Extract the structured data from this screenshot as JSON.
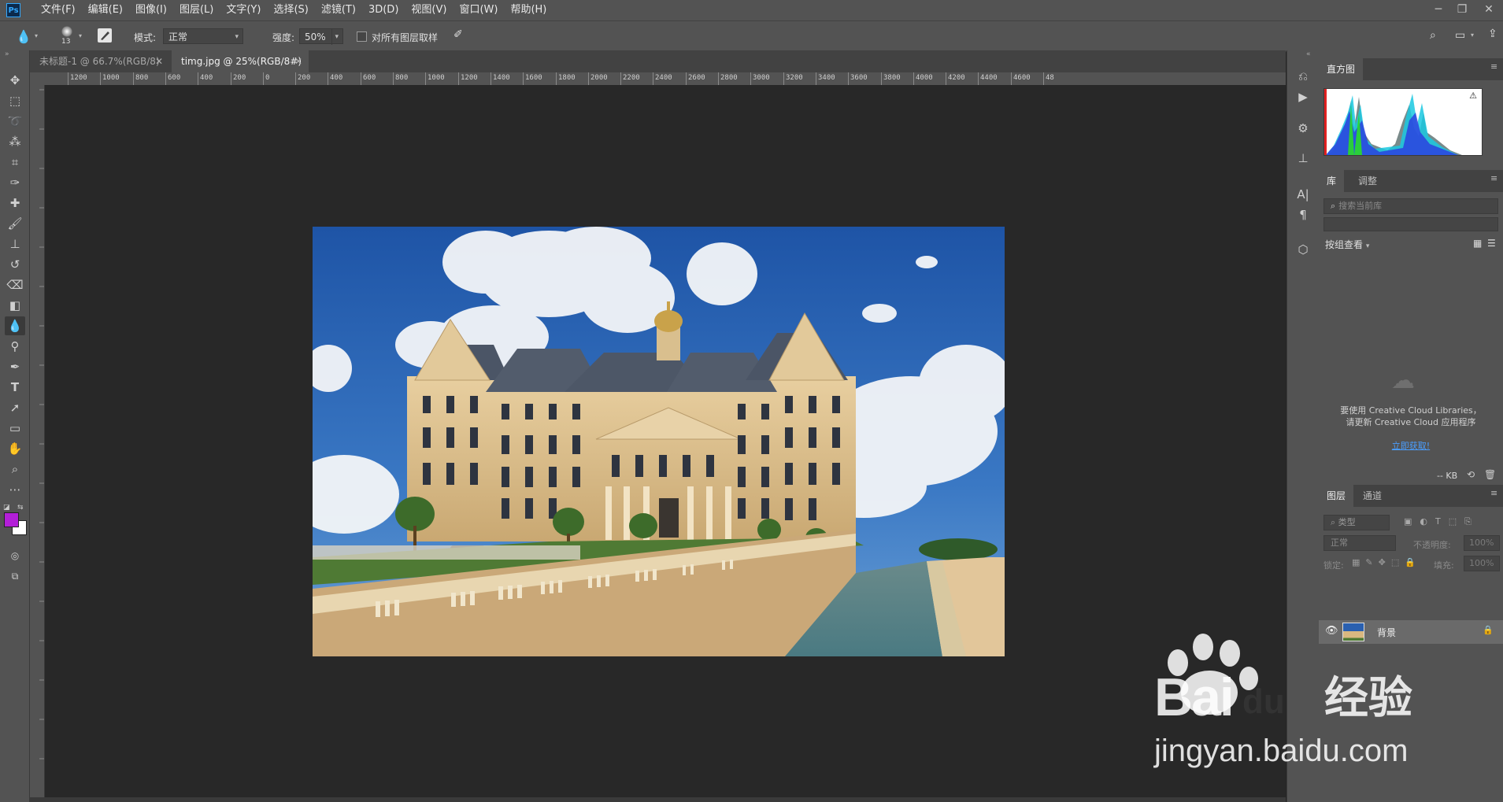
{
  "menubar": {
    "app_icon": "Ps",
    "items": [
      "文件(F)",
      "编辑(E)",
      "图像(I)",
      "图层(L)",
      "文字(Y)",
      "选择(S)",
      "滤镜(T)",
      "3D(D)",
      "视图(V)",
      "窗口(W)",
      "帮助(H)"
    ]
  },
  "options": {
    "brush_size": "13",
    "mode_label": "模式:",
    "mode_value": "正常",
    "strength_label": "强度:",
    "strength_value": "50%",
    "sample_all_layers": "对所有图层取样"
  },
  "tabs": [
    {
      "label": "未标题-1 @ 66.7%(RGB/8)",
      "active": false
    },
    {
      "label": "timg.jpg @ 25%(RGB/8#)",
      "active": true
    }
  ],
  "ruler_labels": [
    "1200",
    "1000",
    "800",
    "600",
    "400",
    "200",
    "0",
    "200",
    "400",
    "600",
    "800",
    "1000",
    "1200",
    "1400",
    "1600",
    "1800",
    "2000",
    "2200",
    "2400",
    "2600",
    "2800",
    "3000",
    "3200",
    "3400",
    "3600",
    "3800",
    "4000",
    "4200",
    "4400",
    "4600",
    "48"
  ],
  "colors": {
    "foreground": "#b31fd8",
    "background": "#ffffff",
    "sky_top": "#1e54a6",
    "accent_link": "#4a9eff"
  },
  "histogram_panel": {
    "tab": "直方图"
  },
  "library_panel": {
    "tabs": [
      "库",
      "调整"
    ],
    "search_placeholder": "搜索当前库",
    "group_view": "按组查看",
    "cc_message_line1": "要使用 Creative Cloud Libraries，",
    "cc_message_line2": "请更新 Creative Cloud 应用程序",
    "update_link": "立即获取!",
    "footer_size": "-- KB"
  },
  "layers_panel": {
    "tabs": [
      "图层",
      "通道"
    ],
    "filter_placeholder": "类型",
    "blend_mode": "正常",
    "opacity_label": "不透明度:",
    "opacity_value": "100%",
    "lock_label": "锁定:",
    "fill_label": "填充:",
    "fill_value": "100%",
    "layers": [
      {
        "name": "背景",
        "visible": true,
        "locked": true
      }
    ]
  },
  "watermark": {
    "brand": "Bai",
    "du": "du",
    "jingyan": "经验",
    "url": "jingyan.baidu.com"
  }
}
